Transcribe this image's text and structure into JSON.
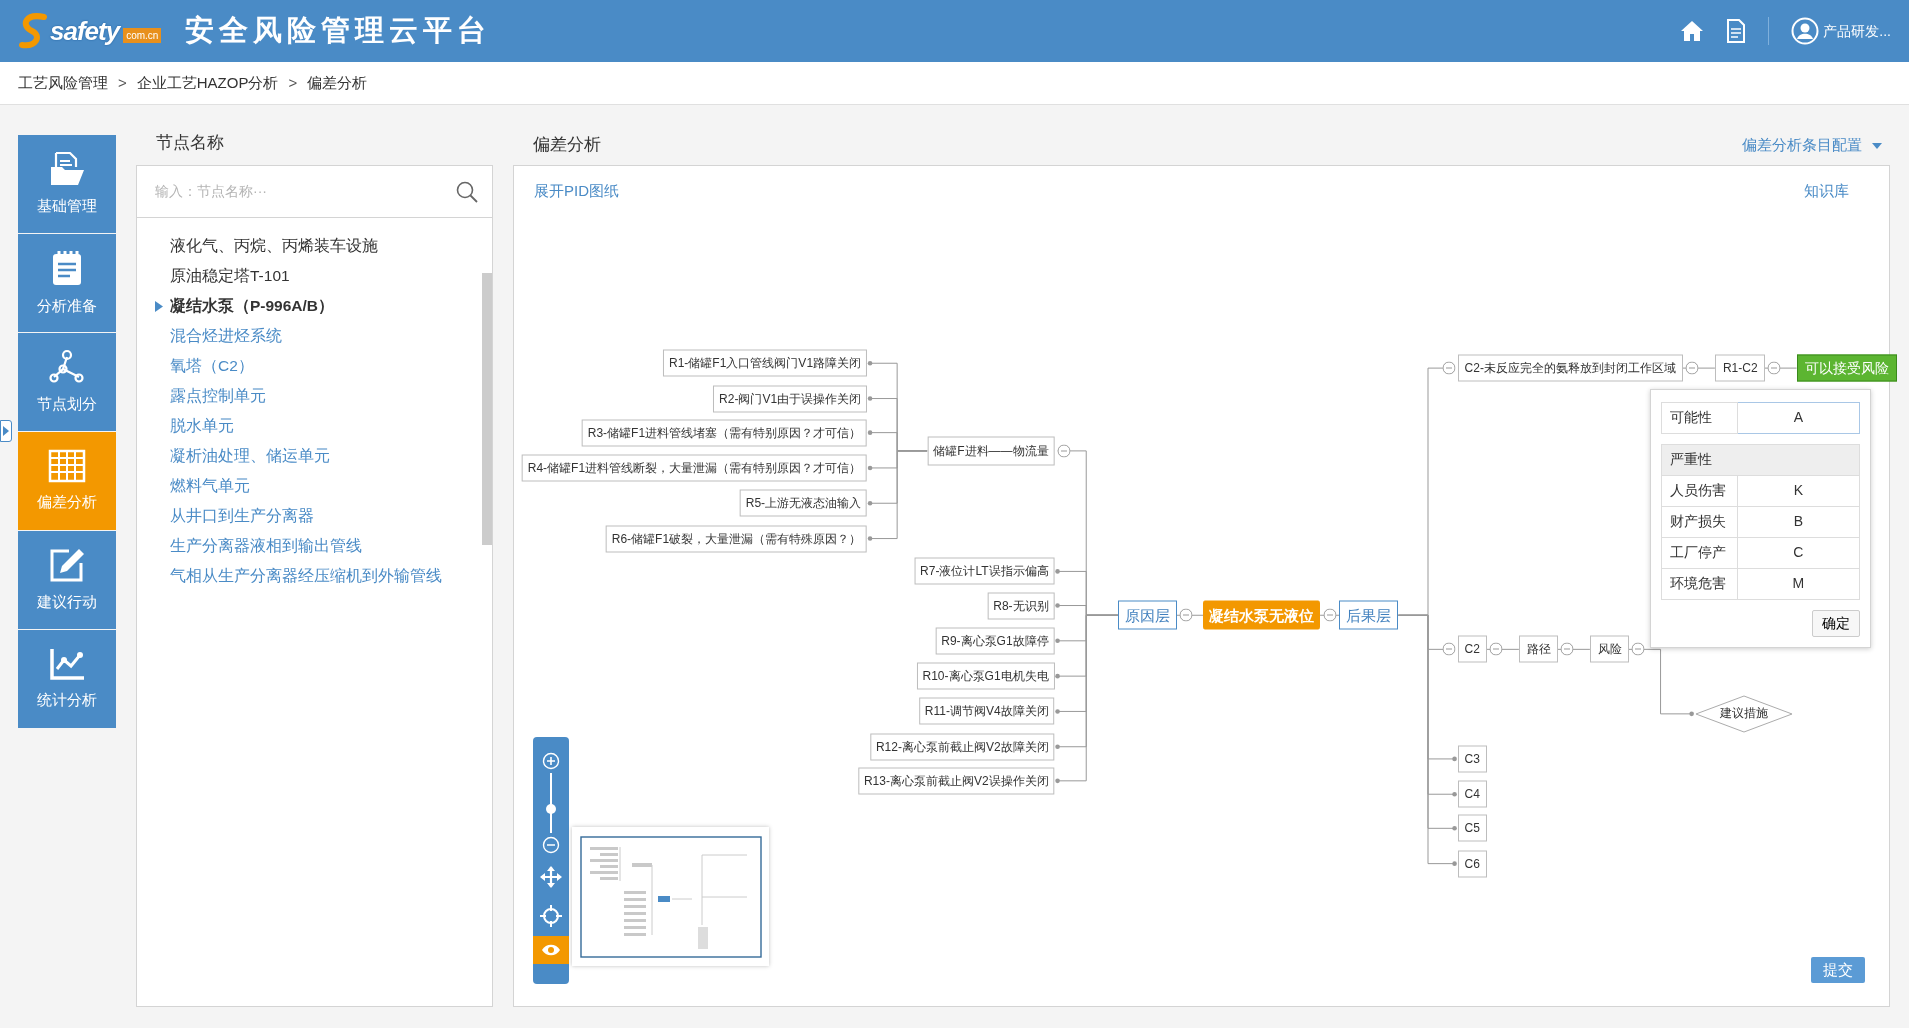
{
  "header": {
    "logo": {
      "name": "safety",
      "domain": "com.cn"
    },
    "title": "安全风险管理云平台",
    "user": "产品研发..."
  },
  "breadcrumb": {
    "separator": ">",
    "items": [
      "工艺风险管理",
      "企业工艺HAZOP分析",
      "偏差分析"
    ]
  },
  "nav": [
    {
      "label": "基础管理",
      "selected": false
    },
    {
      "label": "分析准备",
      "selected": false
    },
    {
      "label": "节点划分",
      "selected": false
    },
    {
      "label": "偏差分析",
      "selected": true
    },
    {
      "label": "建议行动",
      "selected": false
    },
    {
      "label": "统计分析",
      "selected": false
    }
  ],
  "node_panel": {
    "title": "节点名称",
    "search": {
      "placeholder": "输入：节点名称···"
    },
    "items": [
      {
        "label": "液化气、丙烷、丙烯装车设施",
        "kind": "plain",
        "selected": false
      },
      {
        "label": "原油稳定塔T-101",
        "kind": "plain",
        "selected": false
      },
      {
        "label": "凝结水泵（P-996A/B）",
        "kind": "plain",
        "selected": true
      },
      {
        "label": "混合烃进烃系统",
        "kind": "link",
        "selected": false
      },
      {
        "label": "氧塔（C2）",
        "kind": "link",
        "selected": false
      },
      {
        "label": "露点控制单元",
        "kind": "link",
        "selected": false
      },
      {
        "label": "脱水单元",
        "kind": "link",
        "selected": false
      },
      {
        "label": "凝析油处理、储运单元",
        "kind": "link",
        "selected": false
      },
      {
        "label": "燃料气单元",
        "kind": "link",
        "selected": false
      },
      {
        "label": "从井口到生产分离器",
        "kind": "link",
        "selected": false
      },
      {
        "label": "生产分离器液相到输出管线",
        "kind": "link",
        "selected": false
      },
      {
        "label": "气相从生产分离器经压缩机到外输管线",
        "kind": "link",
        "selected": false
      }
    ]
  },
  "analysis": {
    "title": "偏差分析",
    "config_menu": "偏差分析条目配置",
    "pid_link": "展开PID图纸",
    "knowledge_link": "知识库",
    "diagram": {
      "cause_layer": {
        "label": "原因层",
        "kind": "layer",
        "expanded": true,
        "children": [
          {
            "label": "储罐F进料——物流量",
            "kind": "group",
            "expanded": true,
            "children": [
              {
                "label": "R1-储罐F1入口管线阀门V1路障关闭",
                "kind": "cause"
              },
              {
                "label": "R2-阀门V1由于误操作关闭",
                "kind": "cause"
              },
              {
                "label": "R3-储罐F1进料管线堵塞（需有特别原因？才可信）",
                "kind": "cause"
              },
              {
                "label": "R4-储罐F1进料管线断裂，大量泄漏（需有特别原因？才可信）",
                "kind": "cause"
              },
              {
                "label": "R5-上游无液态油输入",
                "kind": "cause"
              },
              {
                "label": "R6-储罐F1破裂，大量泄漏（需有特殊原因？）",
                "kind": "cause"
              }
            ]
          },
          {
            "label": "R7-液位计LT误指示偏高",
            "kind": "cause"
          },
          {
            "label": "R8-无识别",
            "kind": "cause"
          },
          {
            "label": "R9-离心泵G1故障停",
            "kind": "cause"
          },
          {
            "label": "R10-离心泵G1电机失电",
            "kind": "cause"
          },
          {
            "label": "R11-调节阀V4故障关闭",
            "kind": "cause"
          },
          {
            "label": "R12-离心泵前截止阀V2故障关闭",
            "kind": "cause"
          },
          {
            "label": "R13-离心泵前截止阀V2误操作关闭",
            "kind": "cause"
          }
        ]
      },
      "event": {
        "label": "凝结水泵无液位",
        "kind": "event"
      },
      "consequence_layer": {
        "label": "后果层",
        "kind": "layer",
        "expanded": true,
        "children": [
          {
            "label": "C2-未反应完全的氨释放到封闭工作区域",
            "kind": "consequence",
            "expanded": true,
            "children": [
              {
                "label": "R1-C2",
                "kind": "step",
                "expanded": true,
                "children": [
                  {
                    "label": "可以接受风险",
                    "kind": "risk"
                  }
                ]
              }
            ]
          },
          {
            "label": "C2",
            "kind": "consequence",
            "expanded": true,
            "children": [
              {
                "label": "路径",
                "kind": "step",
                "expanded": true,
                "children": [
                  {
                    "label": "风险",
                    "kind": "step",
                    "expanded": true,
                    "children": [
                      {
                        "label": "建议措施",
                        "kind": "measure"
                      }
                    ]
                  }
                ]
              }
            ]
          },
          {
            "label": "C3",
            "kind": "consequence"
          },
          {
            "label": "C4",
            "kind": "consequence"
          },
          {
            "label": "C5",
            "kind": "consequence"
          },
          {
            "label": "C6",
            "kind": "consequence"
          }
        ]
      }
    },
    "risk_popup": {
      "likelihood_label": "可能性",
      "likelihood": "A",
      "severity_title": "严重性",
      "severity": [
        {
          "label": "人员伤害",
          "value": "K"
        },
        {
          "label": "财产损失",
          "value": "B"
        },
        {
          "label": "工厂停产",
          "value": "C"
        },
        {
          "label": "环境危害",
          "value": "M"
        }
      ],
      "confirm": "确定"
    },
    "zoom": {
      "level": 0.4
    },
    "minimap": {
      "visible": true
    },
    "submit": "提交"
  }
}
